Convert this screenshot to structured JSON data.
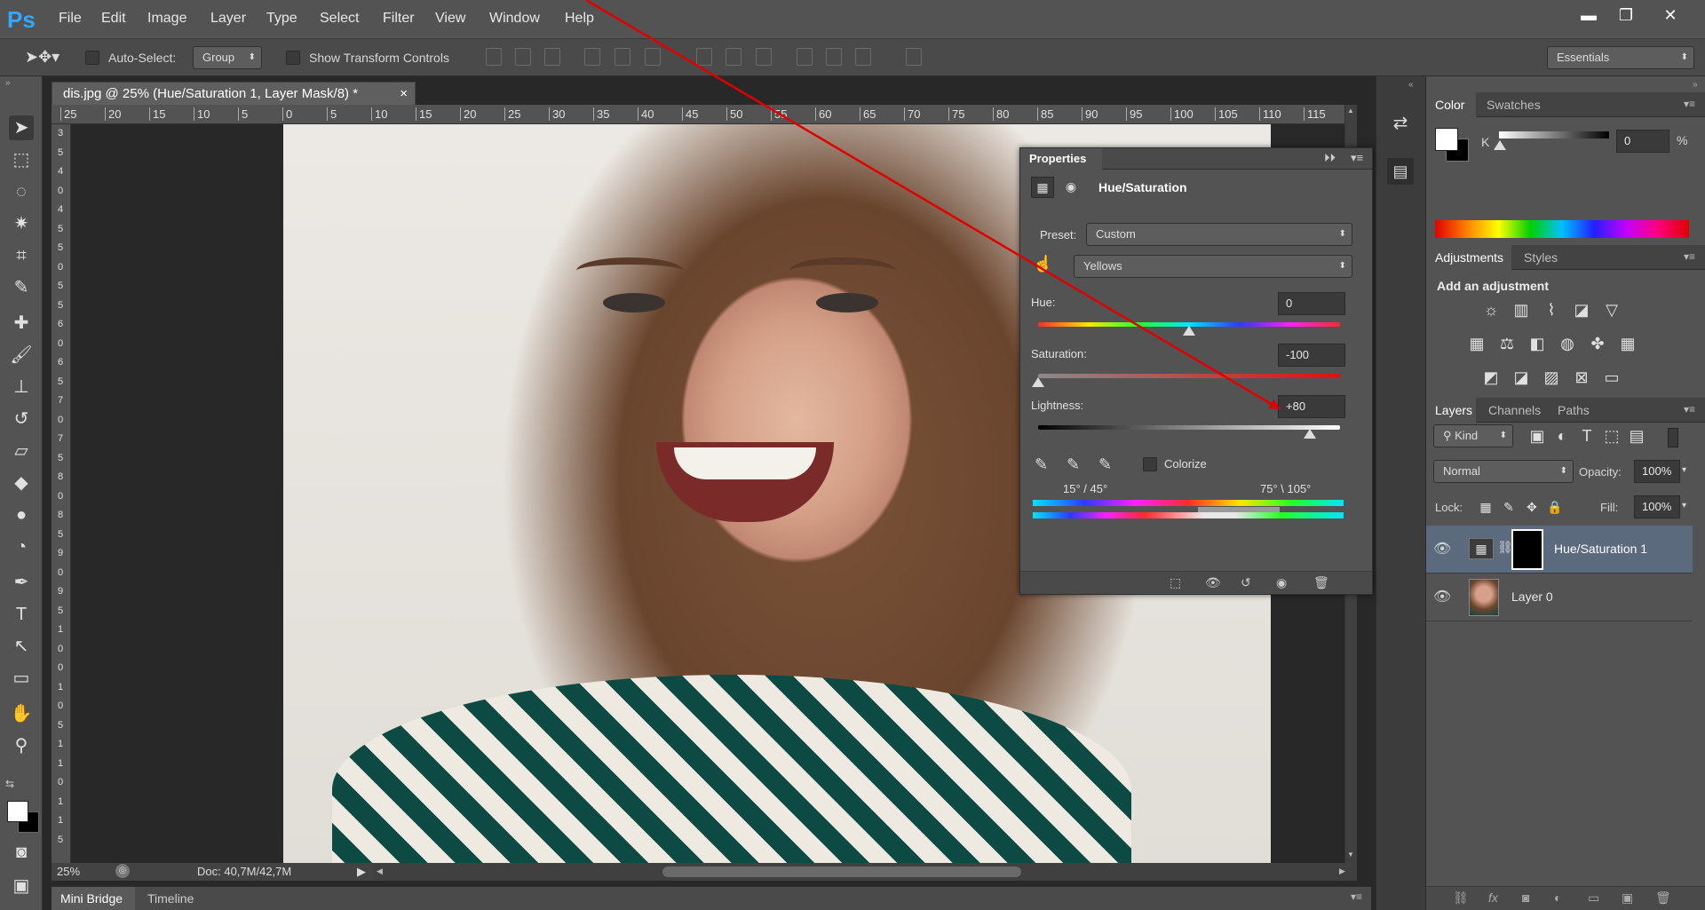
{
  "app": {
    "logo": "Ps"
  },
  "menu": [
    "File",
    "Edit",
    "Image",
    "Layer",
    "Type",
    "Select",
    "Filter",
    "View",
    "Window",
    "Help"
  ],
  "window_controls": {
    "minimize": "▬",
    "restore": "❐",
    "close": "✕"
  },
  "options": {
    "auto_select_label": "Auto-Select:",
    "auto_select_value": "Group",
    "show_transform_label": "Show Transform Controls",
    "workspace": "Essentials"
  },
  "document": {
    "tab_title": "dis.jpg @ 25% (Hue/Saturation 1, Layer Mask/8) *",
    "close": "×",
    "zoom": "25%",
    "doc_size": "Doc: 40,7M/42,7M"
  },
  "ruler_h": [
    "25",
    "20",
    "15",
    "10",
    "5",
    "0",
    "5",
    "10",
    "15",
    "20",
    "25",
    "30",
    "35",
    "40",
    "45",
    "50",
    "55",
    "60",
    "65",
    "70",
    "75",
    "80",
    "85",
    "90",
    "95",
    "100",
    "105",
    "110",
    "115",
    "1"
  ],
  "ruler_v": [
    "3",
    "5",
    "4",
    "0",
    "4",
    "5",
    "5",
    "0",
    "5",
    "5",
    "6",
    "0",
    "6",
    "5",
    "7",
    "0",
    "7",
    "5",
    "8",
    "0",
    "8",
    "5",
    "9",
    "0",
    "9",
    "5",
    "1",
    "0",
    "0",
    "1",
    "0",
    "5",
    "1",
    "1",
    "0",
    "1",
    "1",
    "5"
  ],
  "bottom_tabs": [
    "Mini Bridge",
    "Timeline"
  ],
  "properties": {
    "title": "Properties",
    "adjustment": "Hue/Saturation",
    "preset_label": "Preset:",
    "preset_value": "Custom",
    "channel_value": "Yellows",
    "hue_label": "Hue:",
    "hue_value": "0",
    "hue_level": 0.5,
    "saturation_label": "Saturation:",
    "saturation_value": "-100",
    "saturation_level": 0.0,
    "lightness_label": "Lightness:",
    "lightness_value": "+80",
    "lightness_level": 0.9,
    "colorize_label": "Colorize",
    "range_left": "15° / 45°",
    "range_right": "75° \\ 105°"
  },
  "color_panel": {
    "tabs": [
      "Color",
      "Swatches"
    ],
    "channel_label": "K",
    "k_value": "0",
    "unit": "%"
  },
  "adjustments_panel": {
    "tabs": [
      "Adjustments",
      "Styles"
    ],
    "heading": "Add an adjustment"
  },
  "layers_panel": {
    "tabs": [
      "Layers",
      "Channels",
      "Paths"
    ],
    "filter_kind": "Kind",
    "blend_mode": "Normal",
    "opacity_label": "Opacity:",
    "opacity_value": "100%",
    "lock_label": "Lock:",
    "fill_label": "Fill:",
    "fill_value": "100%",
    "layers": [
      {
        "name": "Hue/Saturation 1",
        "selected": true
      },
      {
        "name": "Layer 0",
        "selected": false
      }
    ]
  },
  "colors": {
    "annotation_arrow": "#e00000",
    "selection": "#5c6a7e",
    "ps_blue": "#31a8ff"
  }
}
